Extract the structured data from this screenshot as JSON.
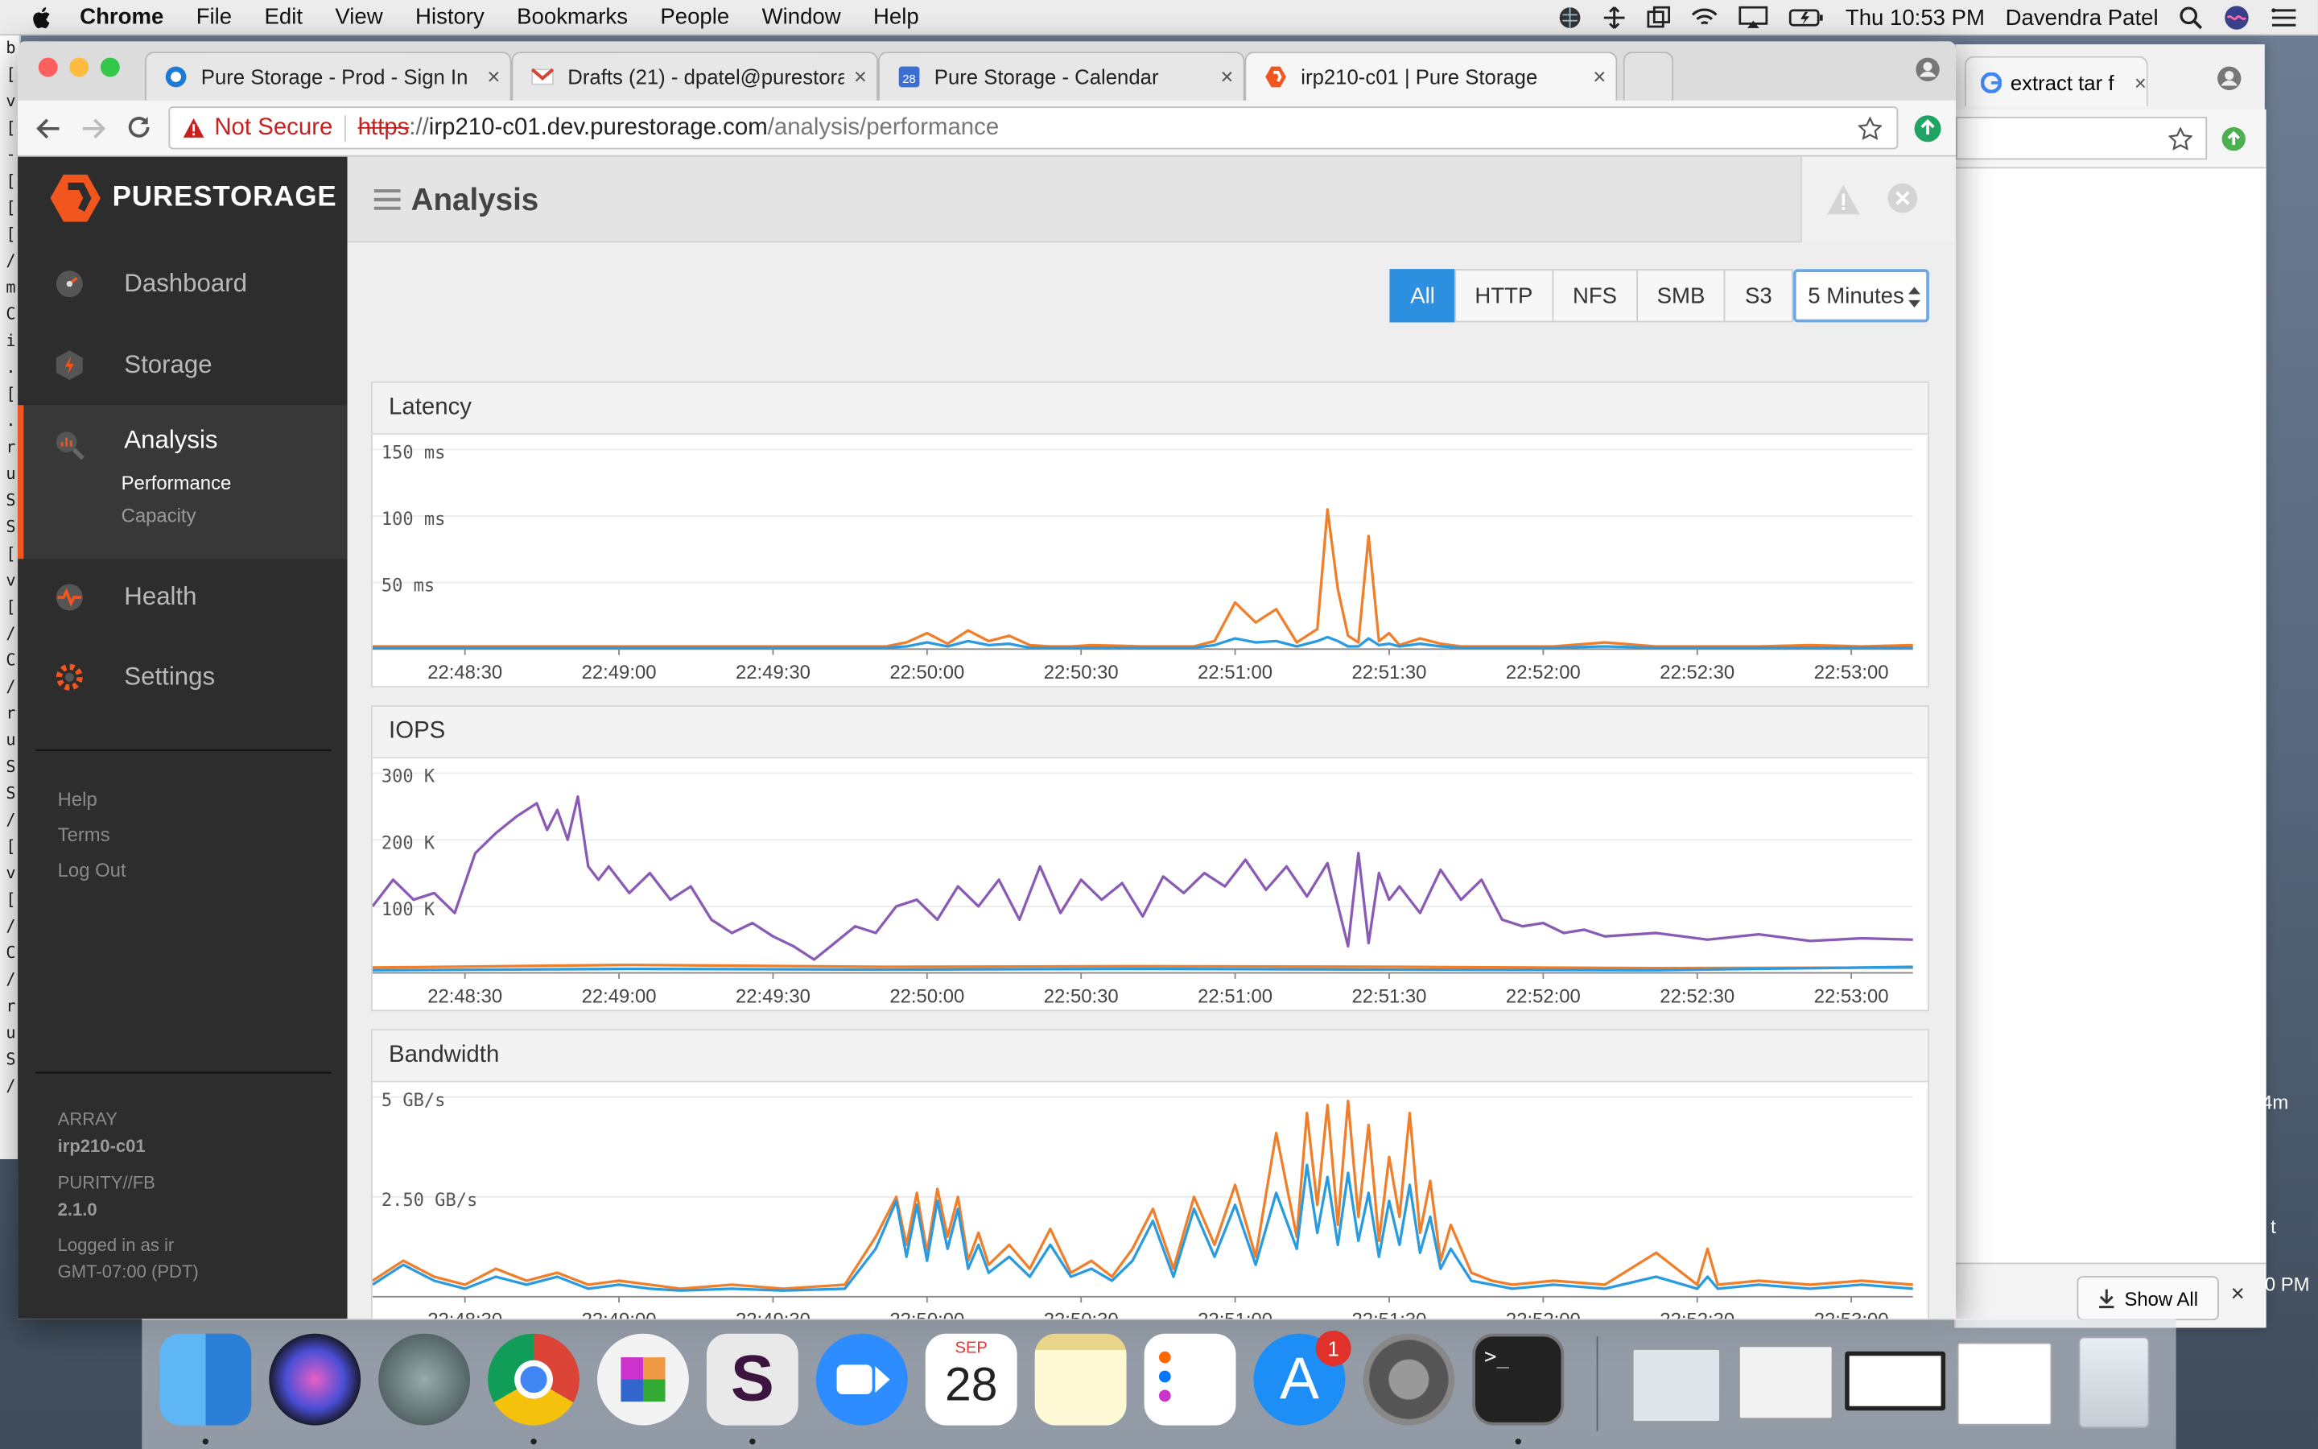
{
  "menubar": {
    "app": "Chrome",
    "items": [
      "File",
      "Edit",
      "View",
      "History",
      "Bookmarks",
      "People",
      "Window",
      "Help"
    ],
    "clock": "Thu 10:53 PM",
    "user": "Davendra Patel"
  },
  "browser": {
    "tabs": [
      {
        "title": "Pure Storage - Prod - Sign In",
        "icon": "okta-icon"
      },
      {
        "title": "Drafts (21) - dpatel@purestora",
        "icon": "gmail-icon"
      },
      {
        "title": "Pure Storage - Calendar",
        "icon": "calendar-icon",
        "badge": "28"
      },
      {
        "title": "irp210-c01 | Pure Storage",
        "icon": "purestorage-icon",
        "active": true
      }
    ],
    "security_label": "Not Secure",
    "url_scheme": "https",
    "url_sep": "://",
    "url_host": "irp210-c01.dev.purestorage.com",
    "url_path": "/analysis/performance"
  },
  "background_window": {
    "tab_title": "extract tar f",
    "download_button": "Show All"
  },
  "background_terminal_fragments": [
    "4m",
    "t",
    "0 PM"
  ],
  "app": {
    "logo_text": "PURESTORAGE",
    "page_title": "Analysis",
    "nav": [
      {
        "label": "Dashboard",
        "icon": "dashboard-gauge-icon"
      },
      {
        "label": "Storage",
        "icon": "storage-icon"
      },
      {
        "label": "Analysis",
        "icon": "analysis-icon",
        "active": true,
        "sub": [
          "Performance",
          "Capacity"
        ],
        "active_sub": "Performance"
      },
      {
        "label": "Health",
        "icon": "health-icon"
      },
      {
        "label": "Settings",
        "icon": "settings-icon"
      }
    ],
    "links": [
      "Help",
      "Terms",
      "Log Out"
    ],
    "footer": {
      "array_label": "ARRAY",
      "array_name": "irp210-c01",
      "os_label": "PURITY//FB",
      "os_version": "2.1.0",
      "login": "Logged in as ir",
      "tz": "GMT-07:00 (PDT)"
    },
    "protocol_filters": [
      "All",
      "HTTP",
      "NFS",
      "SMB",
      "S3"
    ],
    "active_filter": "All",
    "time_range": "5 Minutes"
  },
  "colors": {
    "orange": "#f07f2c",
    "blue": "#2b9be0",
    "purple": "#8a5bb5",
    "accent": "#2d8fe0",
    "brand": "#f2551e"
  },
  "chart_data": [
    {
      "type": "line",
      "title": "Latency",
      "x": [
        "22:48:30",
        "22:49:00",
        "22:49:30",
        "22:50:00",
        "22:50:30",
        "22:51:00",
        "22:51:30",
        "22:52:00",
        "22:52:30",
        "22:53:00"
      ],
      "ylim": [
        0,
        150
      ],
      "yticks": [
        "150 ms",
        "100 ms",
        "50 ms"
      ],
      "series": [
        {
          "color": "#f07f2c",
          "seconds": [
            0,
            20,
            40,
            60,
            80,
            100,
            104,
            108,
            112,
            116,
            120,
            124,
            128,
            132,
            136,
            140,
            150,
            160,
            164,
            168,
            172,
            176,
            180,
            184,
            186,
            188,
            190,
            192,
            194,
            196,
            198,
            200,
            204,
            208,
            212,
            216,
            220,
            230,
            240,
            250,
            260,
            270,
            280,
            290,
            300
          ],
          "values": [
            2,
            2,
            2,
            2,
            2,
            2,
            5,
            12,
            4,
            14,
            6,
            10,
            3,
            2,
            2,
            3,
            2,
            2,
            6,
            35,
            20,
            30,
            5,
            15,
            105,
            45,
            10,
            5,
            85,
            6,
            12,
            3,
            8,
            4,
            2,
            2,
            2,
            2,
            5,
            2,
            2,
            2,
            3,
            2,
            3
          ]
        },
        {
          "color": "#2b9be0",
          "seconds": [
            0,
            20,
            40,
            60,
            80,
            100,
            104,
            108,
            112,
            116,
            120,
            124,
            128,
            132,
            136,
            140,
            150,
            160,
            164,
            168,
            172,
            176,
            180,
            184,
            186,
            188,
            190,
            192,
            194,
            196,
            198,
            200,
            204,
            208,
            212,
            216,
            220,
            230,
            240,
            250,
            260,
            270,
            280,
            290,
            300
          ],
          "values": [
            1,
            1,
            1,
            1,
            1,
            1,
            2,
            5,
            2,
            6,
            3,
            4,
            1,
            1,
            1,
            1,
            1,
            1,
            3,
            8,
            5,
            6,
            2,
            6,
            9,
            6,
            2,
            2,
            8,
            3,
            4,
            2,
            4,
            2,
            1,
            1,
            1,
            1,
            2,
            1,
            1,
            1,
            1,
            1,
            1
          ]
        }
      ]
    },
    {
      "type": "line",
      "title": "IOPS",
      "x": [
        "22:48:30",
        "22:49:00",
        "22:49:30",
        "22:50:00",
        "22:50:30",
        "22:51:00",
        "22:51:30",
        "22:52:00",
        "22:52:30",
        "22:53:00"
      ],
      "ylim": [
        0,
        300000
      ],
      "yticks": [
        "300 K",
        "200 K",
        "100 K"
      ],
      "series": [
        {
          "color": "#8a5bb5",
          "seconds": [
            0,
            4,
            8,
            12,
            16,
            20,
            24,
            28,
            32,
            34,
            36,
            38,
            40,
            42,
            44,
            46,
            50,
            54,
            58,
            62,
            66,
            70,
            74,
            78,
            82,
            86,
            90,
            94,
            98,
            102,
            106,
            110,
            114,
            118,
            122,
            126,
            130,
            134,
            138,
            142,
            146,
            150,
            154,
            158,
            162,
            166,
            170,
            174,
            178,
            182,
            186,
            190,
            192,
            194,
            196,
            198,
            200,
            204,
            208,
            212,
            216,
            220,
            224,
            228,
            232,
            236,
            240,
            250,
            260,
            270,
            280,
            290,
            300
          ],
          "values": [
            100000,
            140000,
            110000,
            120000,
            90000,
            180000,
            210000,
            235000,
            255000,
            215000,
            245000,
            200000,
            265000,
            160000,
            140000,
            160000,
            120000,
            150000,
            110000,
            130000,
            80000,
            60000,
            75000,
            55000,
            40000,
            20000,
            45000,
            70000,
            60000,
            100000,
            110000,
            80000,
            130000,
            100000,
            140000,
            80000,
            160000,
            90000,
            140000,
            110000,
            135000,
            85000,
            145000,
            120000,
            150000,
            130000,
            170000,
            125000,
            160000,
            115000,
            165000,
            40000,
            180000,
            45000,
            150000,
            110000,
            130000,
            90000,
            155000,
            110000,
            140000,
            80000,
            70000,
            75000,
            60000,
            65000,
            55000,
            60000,
            50000,
            58000,
            48000,
            52000,
            50000
          ]
        },
        {
          "color": "#f07f2c",
          "seconds": [
            0,
            50,
            100,
            150,
            200,
            250,
            300
          ],
          "values": [
            8000,
            12000,
            9000,
            10000,
            9000,
            7000,
            8000
          ]
        },
        {
          "color": "#2b9be0",
          "seconds": [
            0,
            50,
            100,
            150,
            200,
            250,
            300
          ],
          "values": [
            4000,
            6000,
            5000,
            6000,
            5000,
            4000,
            9000
          ]
        }
      ]
    },
    {
      "type": "line",
      "title": "Bandwidth",
      "x": [
        "22:48:30",
        "22:49:00",
        "22:49:30",
        "22:50:00",
        "22:50:30",
        "22:51:00",
        "22:51:30",
        "22:52:00",
        "22:52:30",
        "22:53:00"
      ],
      "ylim": [
        0,
        5
      ],
      "yticks": [
        "5 GB/s",
        "2.50 GB/s"
      ],
      "series": [
        {
          "color": "#f07f2c",
          "seconds": [
            0,
            6,
            12,
            18,
            24,
            30,
            36,
            42,
            48,
            54,
            60,
            70,
            80,
            92,
            98,
            102,
            104,
            106,
            108,
            110,
            112,
            114,
            116,
            118,
            120,
            124,
            128,
            132,
            136,
            140,
            144,
            148,
            152,
            156,
            160,
            164,
            168,
            172,
            176,
            180,
            182,
            184,
            186,
            188,
            190,
            192,
            194,
            196,
            198,
            200,
            202,
            204,
            206,
            208,
            210,
            214,
            218,
            222,
            230,
            240,
            250,
            258,
            260,
            262,
            270,
            280,
            290,
            300
          ],
          "values": [
            0.4,
            0.9,
            0.5,
            0.3,
            0.7,
            0.4,
            0.6,
            0.3,
            0.4,
            0.3,
            0.2,
            0.3,
            0.2,
            0.3,
            1.5,
            2.5,
            1.3,
            2.6,
            1.1,
            2.7,
            1.5,
            2.5,
            0.9,
            1.6,
            0.8,
            1.3,
            0.7,
            1.7,
            0.6,
            0.9,
            0.5,
            1.2,
            2.2,
            0.7,
            2.5,
            1.3,
            2.8,
            1.0,
            4.1,
            1.5,
            4.6,
            2.3,
            4.8,
            1.8,
            4.9,
            2.0,
            4.3,
            1.4,
            3.5,
            2.0,
            4.6,
            1.6,
            2.9,
            0.9,
            1.8,
            0.6,
            0.4,
            0.3,
            0.4,
            0.3,
            1.1,
            0.3,
            1.2,
            0.3,
            0.4,
            0.3,
            0.4,
            0.3
          ]
        },
        {
          "color": "#2b9be0",
          "seconds": [
            0,
            6,
            12,
            18,
            24,
            30,
            36,
            42,
            48,
            54,
            60,
            70,
            80,
            92,
            98,
            102,
            104,
            106,
            108,
            110,
            112,
            114,
            116,
            118,
            120,
            124,
            128,
            132,
            136,
            140,
            144,
            148,
            152,
            156,
            160,
            164,
            168,
            172,
            176,
            180,
            182,
            184,
            186,
            188,
            190,
            192,
            194,
            196,
            198,
            200,
            202,
            204,
            206,
            208,
            210,
            214,
            218,
            222,
            230,
            240,
            250,
            258,
            260,
            262,
            270,
            280,
            290,
            300
          ],
          "values": [
            0.3,
            0.8,
            0.4,
            0.2,
            0.5,
            0.3,
            0.5,
            0.2,
            0.3,
            0.2,
            0.15,
            0.2,
            0.15,
            0.2,
            1.2,
            2.4,
            1.0,
            2.3,
            0.9,
            2.4,
            1.2,
            2.2,
            0.7,
            1.3,
            0.6,
            1.0,
            0.5,
            1.3,
            0.5,
            0.7,
            0.4,
            0.9,
            1.9,
            0.5,
            2.2,
            1.0,
            2.3,
            0.8,
            2.6,
            1.2,
            3.3,
            1.6,
            3.0,
            1.3,
            3.1,
            1.4,
            2.6,
            1.0,
            2.4,
            1.3,
            2.8,
            1.1,
            2.0,
            0.7,
            1.2,
            0.4,
            0.3,
            0.2,
            0.3,
            0.2,
            0.5,
            0.2,
            0.5,
            0.2,
            0.3,
            0.2,
            0.3,
            0.2
          ]
        }
      ]
    }
  ],
  "dock": {
    "apps": [
      "finder-icon",
      "siri-icon",
      "launchpad-icon",
      "chrome-icon",
      "photos-grid-icon",
      "slack-icon",
      "zoom-icon",
      "calendar-icon",
      "notes-icon",
      "reminders-icon",
      "appstore-icon",
      "system-preferences-icon",
      "terminal-icon"
    ],
    "calendar_month": "SEP",
    "calendar_day": "28",
    "appstore_badge": "1"
  }
}
